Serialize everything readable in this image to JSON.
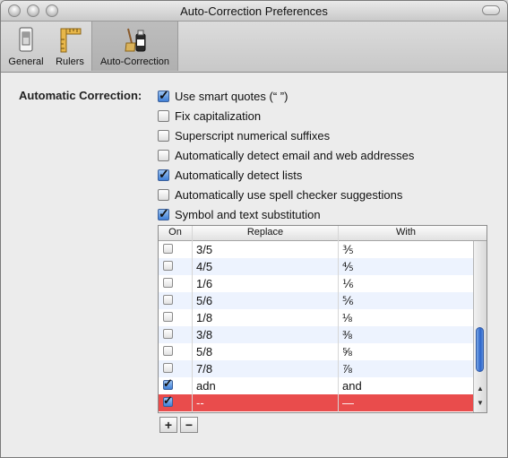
{
  "window": {
    "title": "Auto-Correction Preferences"
  },
  "toolbar": {
    "items": [
      {
        "label": "General",
        "icon": "switch-icon"
      },
      {
        "label": "Rulers",
        "icon": "ruler-icon"
      },
      {
        "label": "Auto-Correction",
        "icon": "broom-bottle-icon",
        "selected": true
      }
    ]
  },
  "section": {
    "label": "Automatic Correction:"
  },
  "options": [
    {
      "label": "Use smart quotes (“ ”)",
      "checked": true
    },
    {
      "label": "Fix capitalization",
      "checked": false
    },
    {
      "label": "Superscript numerical suffixes",
      "checked": false
    },
    {
      "label": "Automatically detect email and web addresses",
      "checked": false
    },
    {
      "label": "Automatically detect lists",
      "checked": true
    },
    {
      "label": "Automatically use spell checker suggestions",
      "checked": false
    },
    {
      "label": "Symbol and text substitution",
      "checked": true
    }
  ],
  "table": {
    "headers": {
      "on": "On",
      "replace": "Replace",
      "with": "With"
    },
    "rows": [
      {
        "on": false,
        "replace": "3/5",
        "with": "⅗"
      },
      {
        "on": false,
        "replace": "4/5",
        "with": "⅘"
      },
      {
        "on": false,
        "replace": "1/6",
        "with": "⅙"
      },
      {
        "on": false,
        "replace": "5/6",
        "with": "⅚"
      },
      {
        "on": false,
        "replace": "1/8",
        "with": "⅛"
      },
      {
        "on": false,
        "replace": "3/8",
        "with": "⅜"
      },
      {
        "on": false,
        "replace": "5/8",
        "with": "⅝"
      },
      {
        "on": false,
        "replace": "7/8",
        "with": "⅞"
      },
      {
        "on": true,
        "replace": "adn",
        "with": "and"
      },
      {
        "on": true,
        "replace": "--",
        "with": "—",
        "selected": true
      }
    ]
  },
  "buttons": {
    "add": "+",
    "remove": "−"
  },
  "colors": {
    "selection": "#e94c4c",
    "checkbox_on": "#3f7fd6",
    "alt_row": "#edf3fe"
  }
}
